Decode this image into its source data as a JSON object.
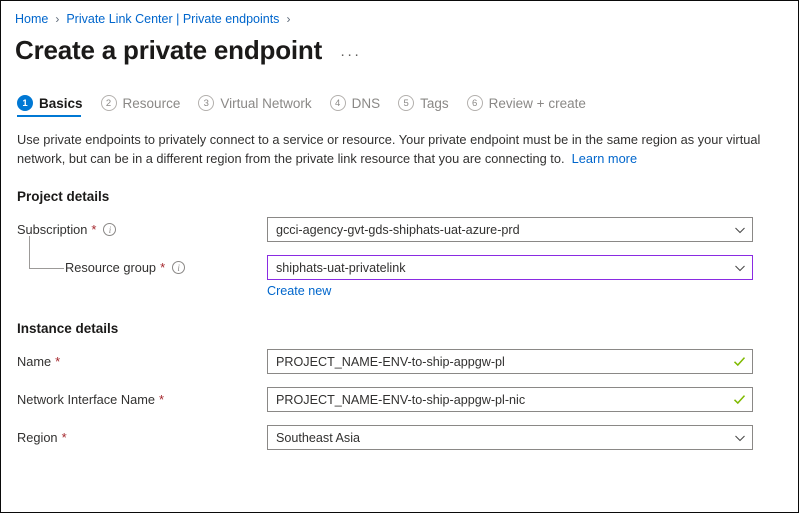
{
  "breadcrumb": {
    "items": [
      {
        "label": "Home"
      },
      {
        "label": "Private Link Center | Private endpoints"
      }
    ],
    "separator": "›"
  },
  "header": {
    "title": "Create a private endpoint",
    "more_options": "···"
  },
  "tabs": [
    {
      "num": "1",
      "label": "Basics",
      "state": "active"
    },
    {
      "num": "2",
      "label": "Resource",
      "state": "inactive"
    },
    {
      "num": "3",
      "label": "Virtual Network",
      "state": "inactive"
    },
    {
      "num": "4",
      "label": "DNS",
      "state": "inactive"
    },
    {
      "num": "5",
      "label": "Tags",
      "state": "inactive"
    },
    {
      "num": "6",
      "label": "Review + create",
      "state": "inactive"
    }
  ],
  "description": {
    "text": "Use private endpoints to privately connect to a service or resource. Your private endpoint must be in the same region as your virtual network, but can be in a different region from the private link resource that you are connecting to.",
    "link_label": "Learn more"
  },
  "project_details": {
    "heading": "Project details",
    "subscription": {
      "label": "Subscription",
      "required": "*",
      "value": "gcci-agency-gvt-gds-shiphats-uat-azure-prd"
    },
    "resource_group": {
      "label": "Resource group",
      "required": "*",
      "value": "shiphats-uat-privatelink",
      "create_new_label": "Create new"
    }
  },
  "instance_details": {
    "heading": "Instance details",
    "name": {
      "label": "Name",
      "required": "*",
      "value": "PROJECT_NAME-ENV-to-ship-appgw-pl"
    },
    "nic_name": {
      "label": "Network Interface Name",
      "required": "*",
      "value": "PROJECT_NAME-ENV-to-ship-appgw-pl-nic"
    },
    "region": {
      "label": "Region",
      "required": "*",
      "value": "Southeast Asia"
    }
  },
  "colors": {
    "accent": "#0078d4",
    "link": "#0066cc",
    "required": "#a4262c",
    "valid": "#7fba00",
    "focus_border": "#8a2be2"
  }
}
